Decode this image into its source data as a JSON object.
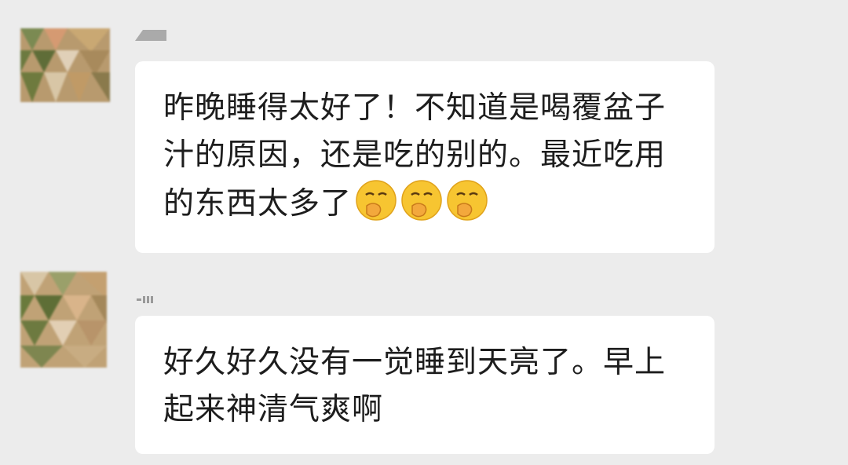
{
  "messages": [
    {
      "text": "昨晚睡得太好了！不知道是喝覆盆子汁的原因，还是吃的别的。最近吃用的东西太多了",
      "emojis": [
        "hand-over-mouth-emoji",
        "hand-over-mouth-emoji",
        "hand-over-mouth-emoji"
      ]
    },
    {
      "text": "好久好久没有一觉睡到天亮了。早上起来神清气爽啊",
      "emojis": []
    }
  ],
  "colors": {
    "background": "#ececec",
    "bubble": "#ffffff",
    "text": "#1d1d1d",
    "emoji": "#f7c531"
  }
}
